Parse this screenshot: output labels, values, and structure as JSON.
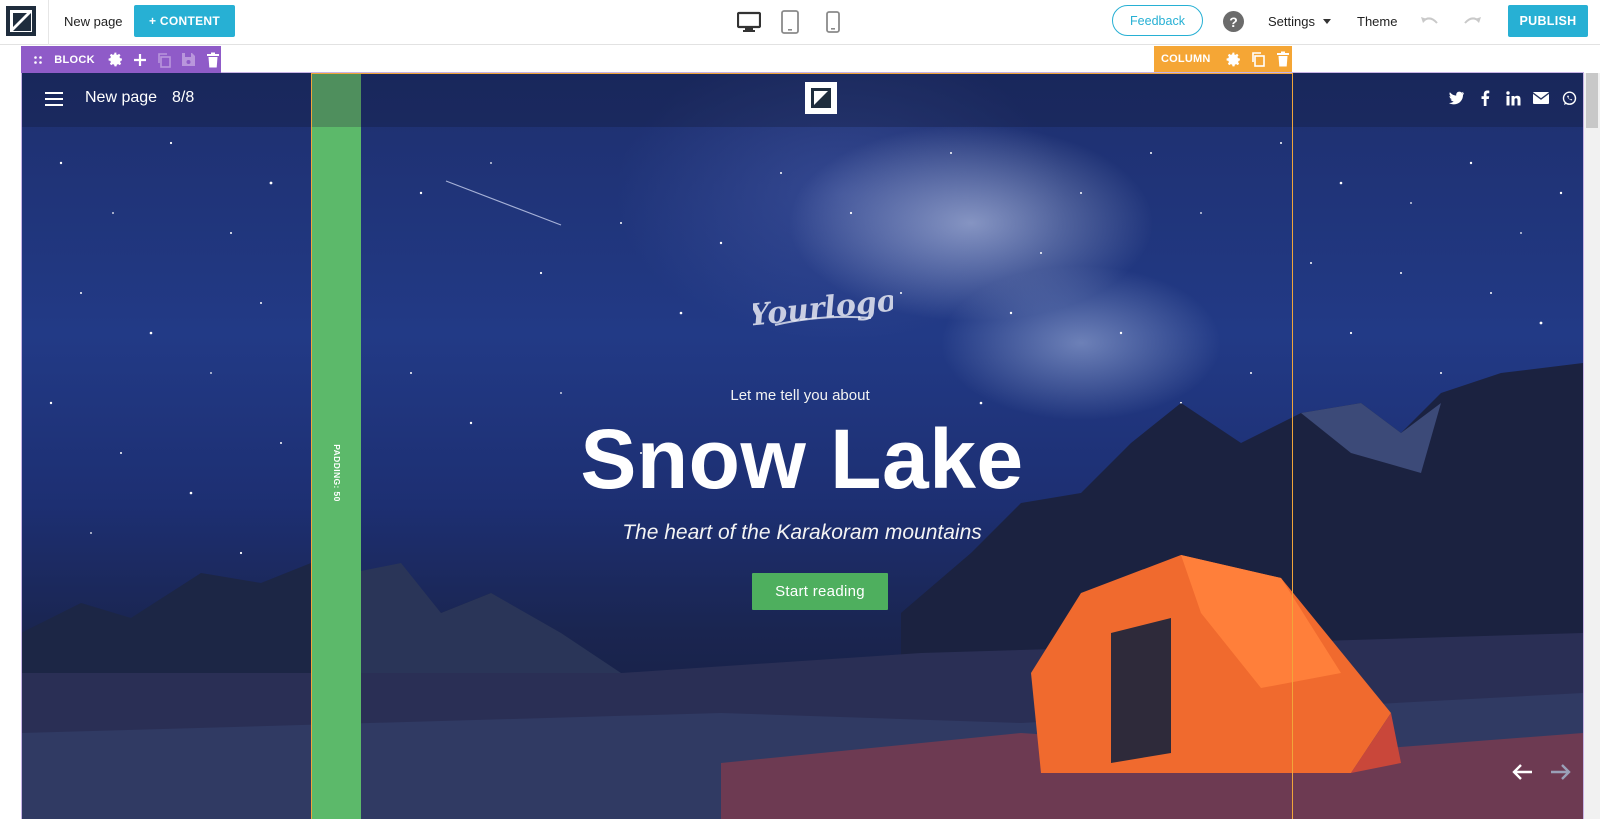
{
  "toolbar": {
    "page_name": "New page",
    "content_button": "+ CONTENT",
    "feedback_button": "Feedback",
    "help": "?",
    "settings_label": "Settings",
    "theme_label": "Theme",
    "publish_button": "PUBLISH",
    "devices": [
      "desktop-icon",
      "tablet-icon",
      "phone-icon"
    ]
  },
  "block_toolbar": {
    "label": "BLOCK",
    "icons": [
      "drag-handle-icon",
      "gear-icon",
      "plus-icon",
      "copy-icon",
      "save-icon",
      "trash-icon"
    ]
  },
  "column_toolbar": {
    "label": "COLUMN",
    "icons": [
      "gear-icon",
      "copy-icon",
      "trash-icon"
    ]
  },
  "site_nav": {
    "title": "New page",
    "page_count": "8/8",
    "socials": [
      "twitter-icon",
      "facebook-icon",
      "linkedin-icon",
      "email-icon",
      "whatsapp-icon"
    ]
  },
  "padding_indicator": "PADDING: 50",
  "hero": {
    "logo_text": "Yourlogo",
    "pretitle": "Let me tell you about",
    "title": "Snow Lake",
    "subtitle": "The heart of the Karakoram mountains",
    "button": "Start reading"
  },
  "colors": {
    "accent": "#27b0d4",
    "block_bar": "#8f5bc8",
    "column_bar": "#f5a635",
    "padding_bar": "#5cb96a",
    "hero_button": "#4eaf5e"
  }
}
